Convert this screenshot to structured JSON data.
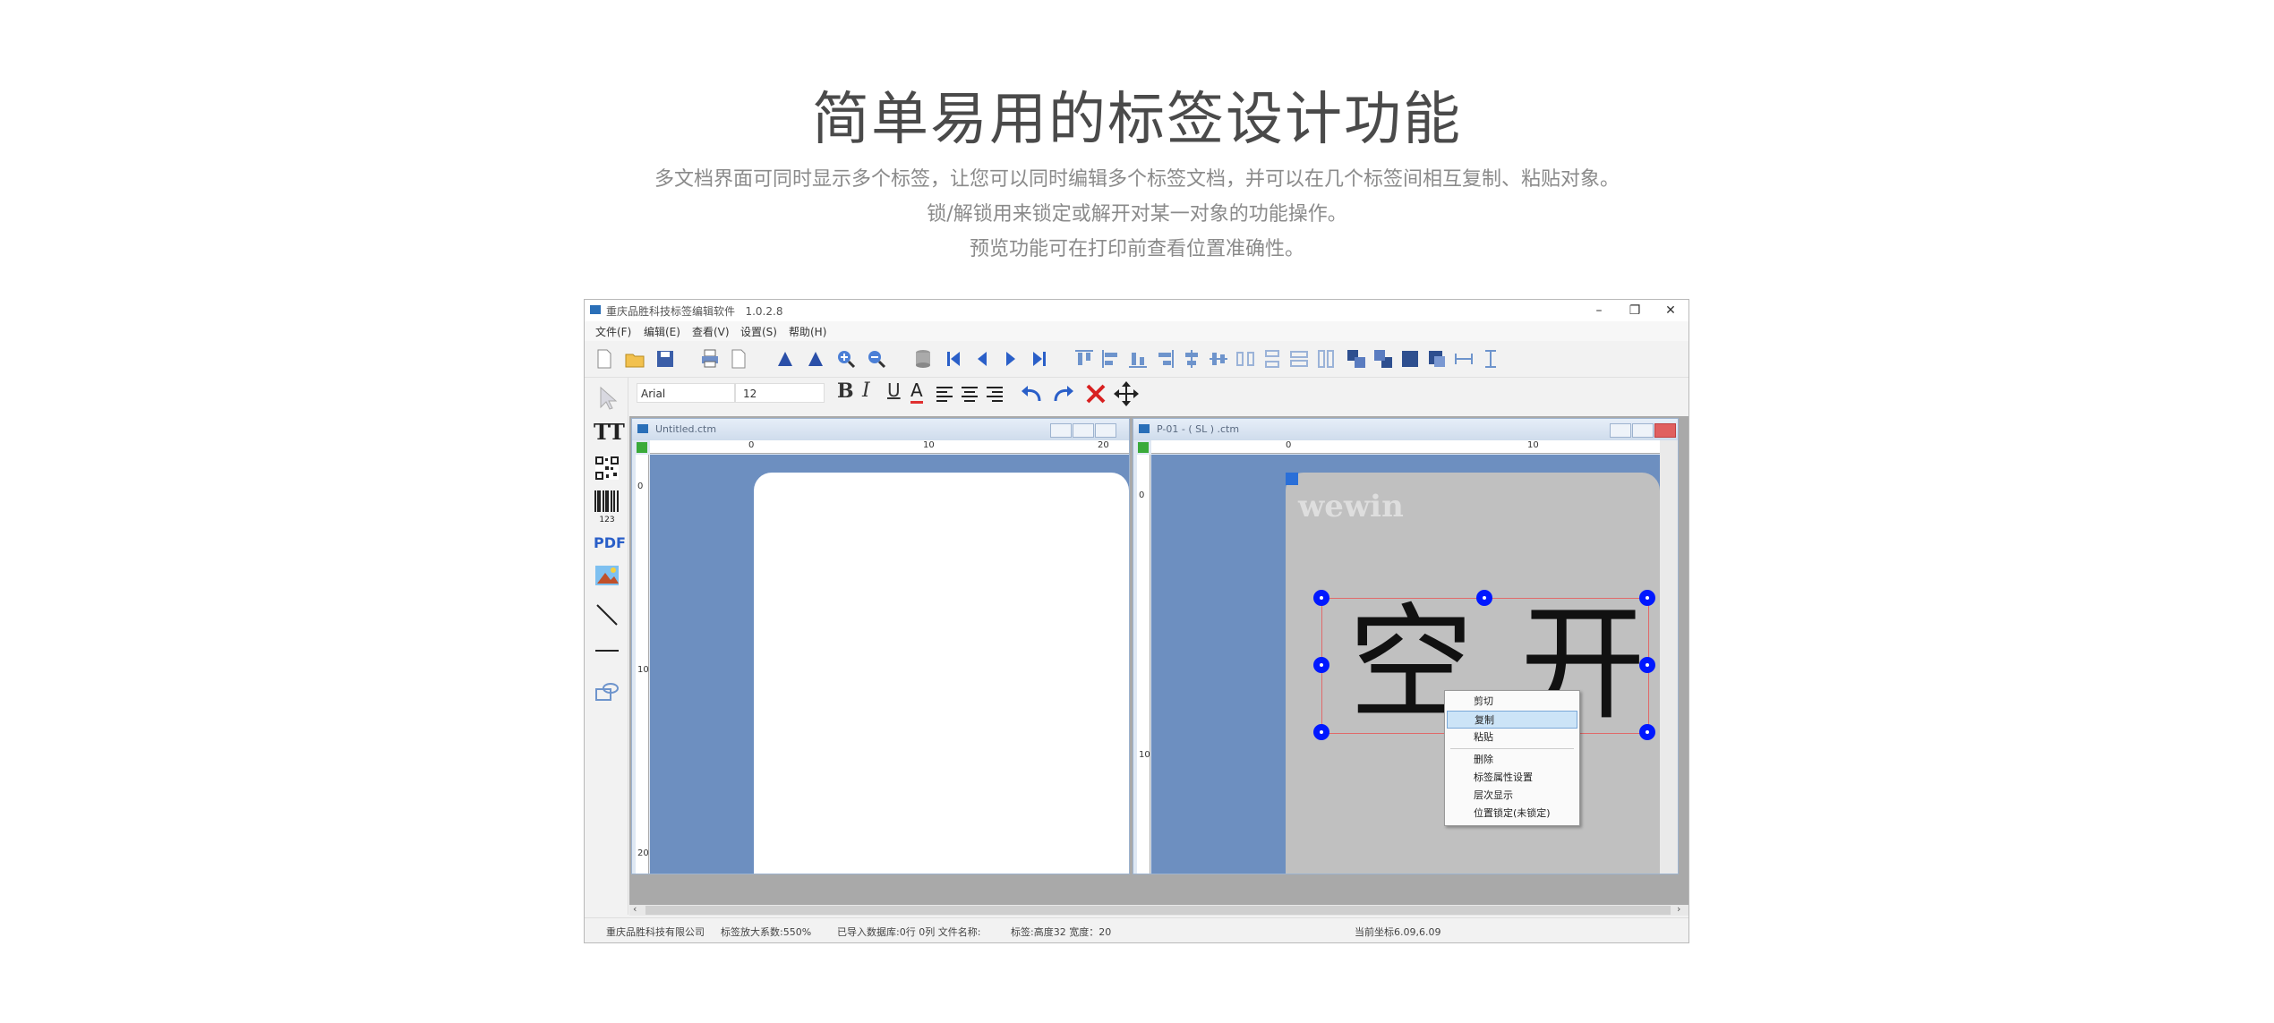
{
  "heading": {
    "title": "简单易用的标签设计功能",
    "lines": [
      "多文档界面可同时显示多个标签，让您可以同时编辑多个标签文档，并可以在几个标签间相互复制、粘贴对象。",
      "锁/解锁用来锁定或解开对某一对象的功能操作。",
      "预览功能可在打印前查看位置准确性。"
    ]
  },
  "app": {
    "title": "重庆品胜科技标签编辑软件",
    "version": "1.0.2.8",
    "window_buttons": {
      "minimize": "–",
      "restore": "❐",
      "close": "✕"
    },
    "menu": [
      "文件(F)",
      "编辑(E)",
      "查看(V)",
      "设置(S)",
      "帮助(H)"
    ],
    "format": {
      "font": "Arial",
      "size": "12",
      "bold": "B",
      "italic": "I",
      "underline": "U",
      "color": "A"
    },
    "left_tools": {
      "text": "TT",
      "barcode_digits": "123",
      "pdf": "PDF"
    },
    "doc1": {
      "title": "Untitled.ctm",
      "ruler_h": [
        "0",
        "10",
        "20"
      ],
      "ruler_v": [
        "0",
        "10",
        "20"
      ]
    },
    "doc2": {
      "title": "P-01 - ( SL ) .ctm",
      "ruler_h": [
        "0",
        "10"
      ],
      "ruler_v": [
        "0",
        "10"
      ],
      "watermark": "wewin",
      "big_text_left": "空",
      "big_text_right": "开"
    },
    "context_menu": [
      "剪切",
      "复制",
      "粘贴",
      "删除",
      "标签属性设置",
      "层次显示",
      "位置锁定(未锁定)"
    ],
    "status": {
      "company": "重庆品胜科技有限公司",
      "zoom": "标签放大系数:550%",
      "imported": "已导入数据库:0行 0列 文件名称:",
      "size": "标签:高度32 宽度：20",
      "coords": "当前坐标6.09,6.09"
    }
  },
  "colors": {
    "canvas_blue": "#6d8fc0",
    "handle_blue": "#0018ff",
    "label_gray": "#c0c0c0",
    "menu_highlight": "#cce4f7"
  }
}
